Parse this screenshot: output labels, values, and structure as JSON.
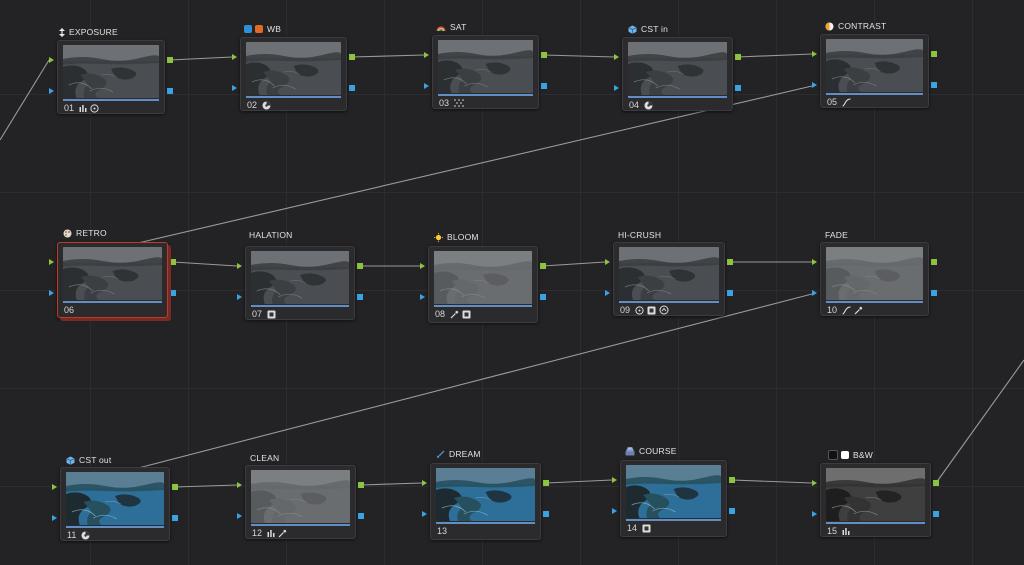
{
  "colors": {
    "wb_blue": "#2f8ed8",
    "wb_orange": "#e36a25",
    "bw_black": "#111111",
    "bw_white": "#ffffff"
  },
  "nodes": [
    {
      "id": "n01",
      "num": "01",
      "label": "EXPOSURE",
      "badge": "vertical-arrows-icon",
      "tone": "gray",
      "tools": [
        "histogram-icon",
        "curve-circle-icon"
      ]
    },
    {
      "id": "n02",
      "num": "02",
      "label": "WB",
      "badge": "color-swatches-icon",
      "tone": "gray",
      "tools": [
        "color-wheel-icon"
      ]
    },
    {
      "id": "n03",
      "num": "03",
      "label": "SAT",
      "badge": "rainbow-icon",
      "tone": "gray",
      "tools": [
        "dotted-grid-icon"
      ]
    },
    {
      "id": "n04",
      "num": "04",
      "label": "CST in",
      "badge": "cube-icon",
      "tone": "gray",
      "tools": [
        "color-wheel-icon"
      ]
    },
    {
      "id": "n05",
      "num": "05",
      "label": "CONTRAST",
      "badge": "half-circle-icon",
      "tone": "gray",
      "tools": [
        "curves-icon"
      ]
    },
    {
      "id": "n06",
      "num": "06",
      "label": "RETRO",
      "badge": "palette-icon",
      "tone": "gray",
      "tools": []
    },
    {
      "id": "n07",
      "num": "07",
      "label": "HALATION",
      "badge": "",
      "tone": "gray",
      "tools": [
        "fx-box-icon"
      ]
    },
    {
      "id": "n08",
      "num": "08",
      "label": "BLOOM",
      "badge": "sun-icon",
      "tone": "light",
      "tools": [
        "eyedropper-icon",
        "fx-box-icon"
      ]
    },
    {
      "id": "n09",
      "num": "09",
      "label": "HI-CRUSH",
      "badge": "",
      "tone": "gray",
      "tools": [
        "curve-circle-icon",
        "fx-box-icon",
        "key-circle-icon"
      ]
    },
    {
      "id": "n10",
      "num": "10",
      "label": "FADE",
      "badge": "",
      "tone": "light",
      "tools": [
        "curves-icon",
        "eyedropper-icon"
      ]
    },
    {
      "id": "n11",
      "num": "11",
      "label": "CST out",
      "badge": "cube-icon",
      "tone": "blue",
      "tools": [
        "color-wheel-icon"
      ]
    },
    {
      "id": "n12",
      "num": "12",
      "label": "CLEAN",
      "badge": "",
      "tone": "light",
      "tools": [
        "histogram-icon",
        "eyedropper-icon"
      ]
    },
    {
      "id": "n13",
      "num": "13",
      "label": "DREAM",
      "badge": "brush-icon",
      "tone": "blue",
      "tools": []
    },
    {
      "id": "n14",
      "num": "14",
      "label": "COURSE",
      "badge": "stack-icon",
      "tone": "blue",
      "tools": [
        "fx-box-icon"
      ]
    },
    {
      "id": "n15",
      "num": "15",
      "label": "B&W",
      "badge": "bw-swatches-icon",
      "tone": "bw",
      "tools": [
        "histogram-icon"
      ]
    }
  ],
  "selected": "n06"
}
